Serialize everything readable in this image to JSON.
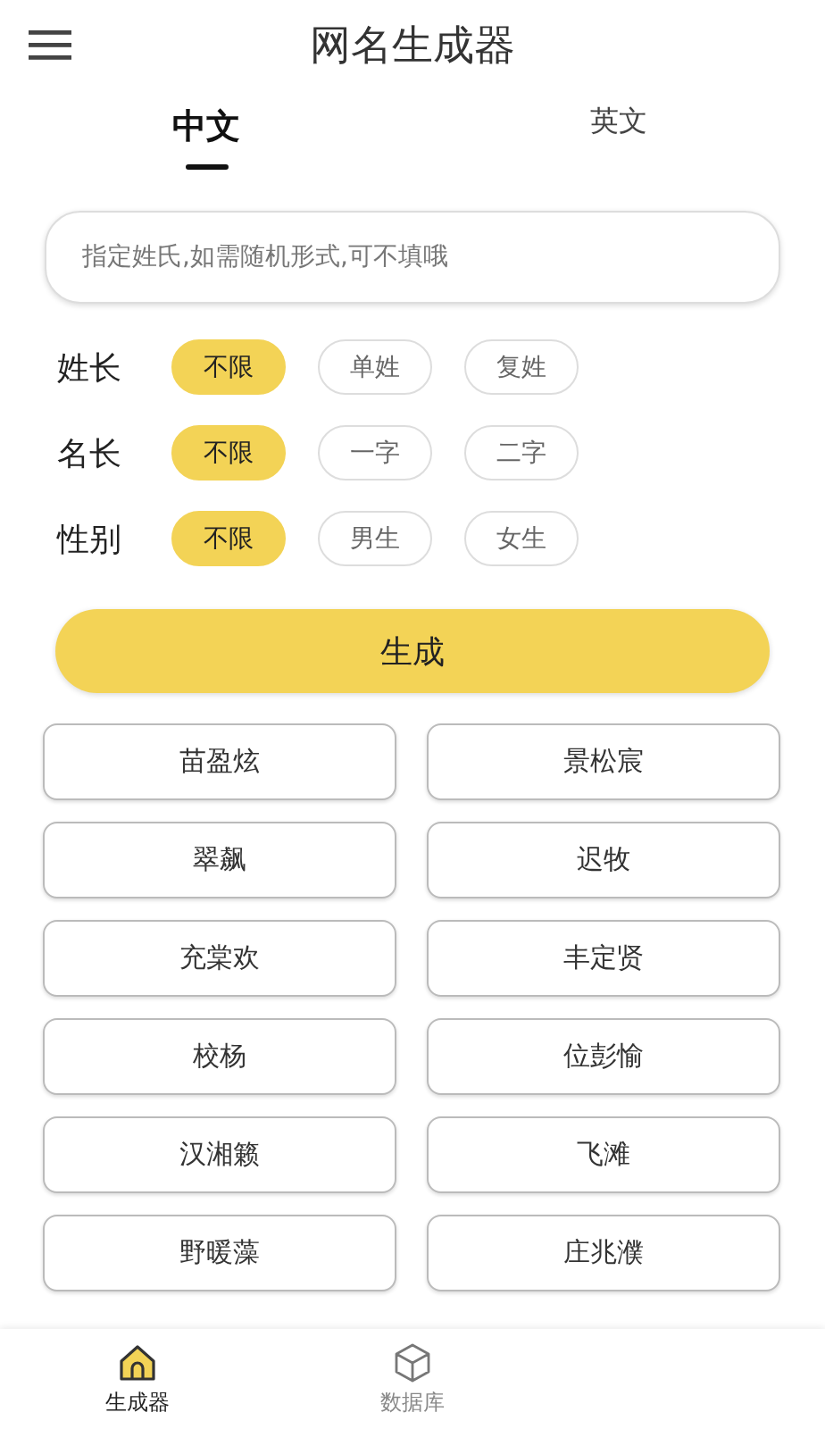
{
  "header": {
    "title": "网名生成器"
  },
  "tabs": [
    {
      "label": "中文",
      "selected": true
    },
    {
      "label": "英文",
      "selected": false
    }
  ],
  "surname_field": {
    "placeholder": "指定姓氏,如需随机形式,可不填哦"
  },
  "filters": [
    {
      "label": "姓长",
      "options": [
        {
          "label": "不限",
          "selected": true
        },
        {
          "label": "单姓",
          "selected": false
        },
        {
          "label": "复姓",
          "selected": false
        }
      ]
    },
    {
      "label": "名长",
      "options": [
        {
          "label": "不限",
          "selected": true
        },
        {
          "label": "一字",
          "selected": false
        },
        {
          "label": "二字",
          "selected": false
        }
      ]
    },
    {
      "label": "性别",
      "options": [
        {
          "label": "不限",
          "selected": true
        },
        {
          "label": "男生",
          "selected": false
        },
        {
          "label": "女生",
          "selected": false
        }
      ]
    }
  ],
  "generate_button": "生成",
  "names": [
    "苗盈炫",
    "景松宸",
    "翠飙",
    "迟牧",
    "充棠欢",
    "丰定贤",
    "校杨",
    "位彭愉",
    "汉湘籁",
    "飞滩",
    "野暖藻",
    "庄兆濮"
  ],
  "bottom_nav": [
    {
      "label": "生成器",
      "kind": "home",
      "selected": true
    },
    {
      "label": "数据库",
      "kind": "cube",
      "selected": false
    }
  ]
}
